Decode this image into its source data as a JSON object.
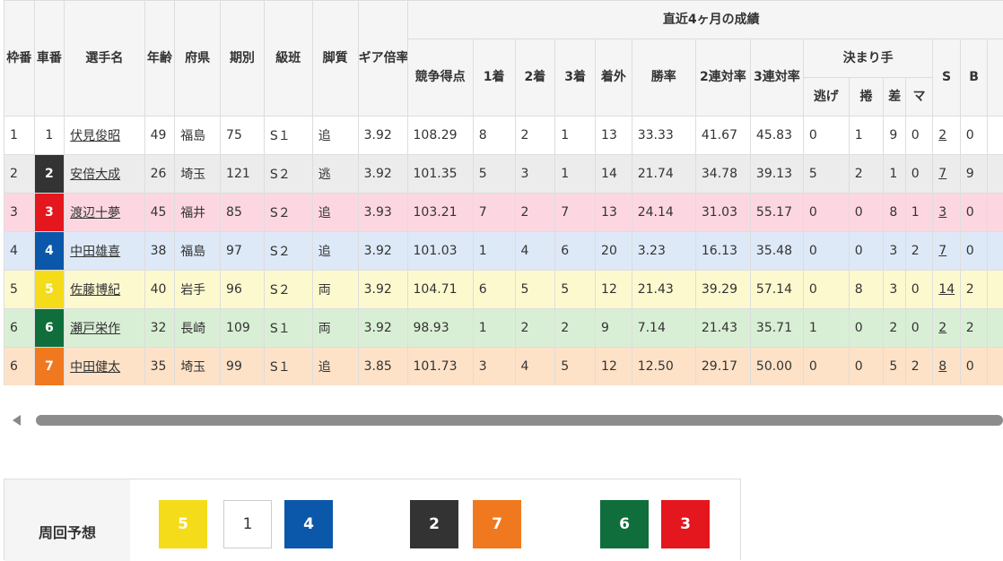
{
  "headers": {
    "waku": "枠番",
    "car": "車番",
    "name": "選手名",
    "age": "年齢",
    "pref": "府県",
    "term": "期別",
    "class": "級班",
    "style": "脚質",
    "gear": "ギア倍率",
    "recent_group": "直近4ヶ月の成績",
    "score": "競争得点",
    "first": "1着",
    "second": "2着",
    "third": "3着",
    "out": "着外",
    "win_rate": "勝率",
    "quinella_rate": "2連対率",
    "trio_rate": "3連対率",
    "kimarite_group": "決まり手",
    "nige": "逃げ",
    "makuri": "捲",
    "sashi": "差",
    "mark": "マ",
    "s": "S",
    "b": "B"
  },
  "rows": [
    {
      "waku": "1",
      "car": "1",
      "name": "伏見俊昭",
      "age": "49",
      "pref": "福島",
      "term": "75",
      "class": "S１",
      "style": "追",
      "gear": "3.92",
      "score": "108.29",
      "first": "8",
      "second": "2",
      "third": "1",
      "out": "13",
      "win_rate": "33.33",
      "quinella_rate": "41.67",
      "trio_rate": "45.83",
      "nige": "0",
      "makuri": "1",
      "sashi": "9",
      "mark": "0",
      "s": "2",
      "b": "0"
    },
    {
      "waku": "2",
      "car": "2",
      "name": "安倍大成",
      "age": "26",
      "pref": "埼玉",
      "term": "121",
      "class": "S２",
      "style": "逃",
      "gear": "3.92",
      "score": "101.35",
      "first": "5",
      "second": "3",
      "third": "1",
      "out": "14",
      "win_rate": "21.74",
      "quinella_rate": "34.78",
      "trio_rate": "39.13",
      "nige": "5",
      "makuri": "2",
      "sashi": "1",
      "mark": "0",
      "s": "7",
      "b": "9"
    },
    {
      "waku": "3",
      "car": "3",
      "name": "渡辺十夢",
      "age": "45",
      "pref": "福井",
      "term": "85",
      "class": "S２",
      "style": "追",
      "gear": "3.93",
      "score": "103.21",
      "first": "7",
      "second": "2",
      "third": "7",
      "out": "13",
      "win_rate": "24.14",
      "quinella_rate": "31.03",
      "trio_rate": "55.17",
      "nige": "0",
      "makuri": "0",
      "sashi": "8",
      "mark": "1",
      "s": "3",
      "b": "0"
    },
    {
      "waku": "4",
      "car": "4",
      "name": "中田雄喜",
      "age": "38",
      "pref": "福島",
      "term": "97",
      "class": "S２",
      "style": "追",
      "gear": "3.92",
      "score": "101.03",
      "first": "1",
      "second": "4",
      "third": "6",
      "out": "20",
      "win_rate": "3.23",
      "quinella_rate": "16.13",
      "trio_rate": "35.48",
      "nige": "0",
      "makuri": "0",
      "sashi": "3",
      "mark": "2",
      "s": "7",
      "b": "0"
    },
    {
      "waku": "5",
      "car": "5",
      "name": "佐藤博紀",
      "age": "40",
      "pref": "岩手",
      "term": "96",
      "class": "S２",
      "style": "両",
      "gear": "3.92",
      "score": "104.71",
      "first": "6",
      "second": "5",
      "third": "5",
      "out": "12",
      "win_rate": "21.43",
      "quinella_rate": "39.29",
      "trio_rate": "57.14",
      "nige": "0",
      "makuri": "8",
      "sashi": "3",
      "mark": "0",
      "s": "14",
      "b": "2"
    },
    {
      "waku": "6",
      "car": "6",
      "name": "瀬戸栄作",
      "age": "32",
      "pref": "長崎",
      "term": "109",
      "class": "S１",
      "style": "両",
      "gear": "3.92",
      "score": "98.93",
      "first": "1",
      "second": "2",
      "third": "2",
      "out": "9",
      "win_rate": "7.14",
      "quinella_rate": "21.43",
      "trio_rate": "35.71",
      "nige": "1",
      "makuri": "0",
      "sashi": "2",
      "mark": "0",
      "s": "2",
      "b": "2"
    },
    {
      "waku": "6",
      "car": "7",
      "name": "中田健太",
      "age": "35",
      "pref": "埼玉",
      "term": "99",
      "class": "S１",
      "style": "追",
      "gear": "3.85",
      "score": "101.73",
      "first": "3",
      "second": "4",
      "third": "5",
      "out": "12",
      "win_rate": "12.50",
      "quinella_rate": "29.17",
      "trio_rate": "50.00",
      "nige": "0",
      "makuri": "0",
      "sashi": "5",
      "mark": "2",
      "s": "8",
      "b": "0"
    }
  ],
  "forecast": {
    "label": "周回予想",
    "items": [
      {
        "number": "5",
        "color": "#f4dc1a"
      },
      {
        "number": "1",
        "color": "#ffffff"
      },
      {
        "number": "4",
        "color": "#0b57a9"
      },
      {
        "number": "2",
        "color": "#333333"
      },
      {
        "number": "7",
        "color": "#f0791f"
      },
      {
        "number": "6",
        "color": "#0f6e3b"
      },
      {
        "number": "3",
        "color": "#e4161e"
      }
    ]
  },
  "colors": {
    "car_1": "#ffffff",
    "car_2": "#333333",
    "car_3": "#e4161e",
    "car_4": "#0b57a9",
    "car_5": "#f4dc1a",
    "car_6": "#0f6e3b",
    "car_7": "#f0791f"
  }
}
